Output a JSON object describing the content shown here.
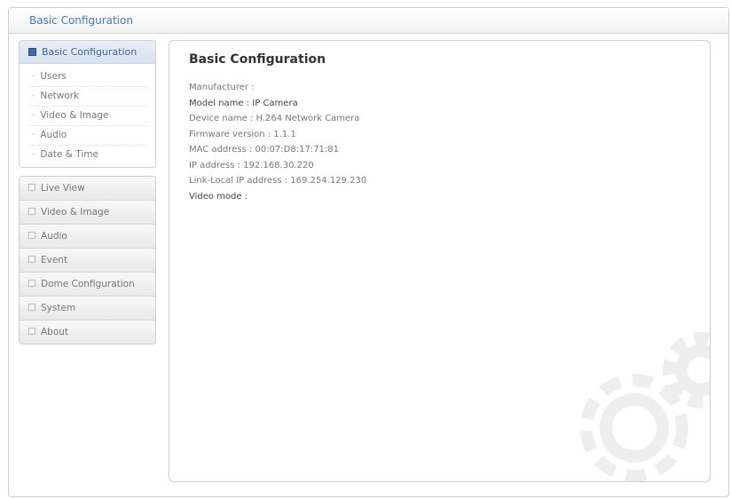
{
  "window": {
    "title": "Basic Configuration"
  },
  "sidebar": {
    "active_section": {
      "label": "Basic Configuration",
      "items": [
        {
          "label": "Users"
        },
        {
          "label": "Network"
        },
        {
          "label": "Video & Image"
        },
        {
          "label": "Audio"
        },
        {
          "label": "Date & Time"
        }
      ]
    },
    "menu": [
      {
        "label": "Live View"
      },
      {
        "label": "Video & Image"
      },
      {
        "label": "Audio"
      },
      {
        "label": "Event"
      },
      {
        "label": "Dome Configuration"
      },
      {
        "label": "System"
      },
      {
        "label": "About"
      }
    ]
  },
  "main": {
    "title": "Basic Configuration",
    "info": [
      {
        "text": "Manufacturer :"
      },
      {
        "text": "Model name : IP Camera"
      },
      {
        "text": "Device name : H.264 Network Camera"
      },
      {
        "text": "Firmware version : 1.1.1"
      },
      {
        "text": "MAC address : 00:07:D8:17:71:81"
      },
      {
        "text": "IP address : 192.168.30.220"
      },
      {
        "text": "Link-Local IP address : 169.254.129.230"
      },
      {
        "text": "Video mode :"
      }
    ]
  },
  "colors": {
    "accent": "#4a78b0",
    "active_header": "#d7e1ef"
  }
}
